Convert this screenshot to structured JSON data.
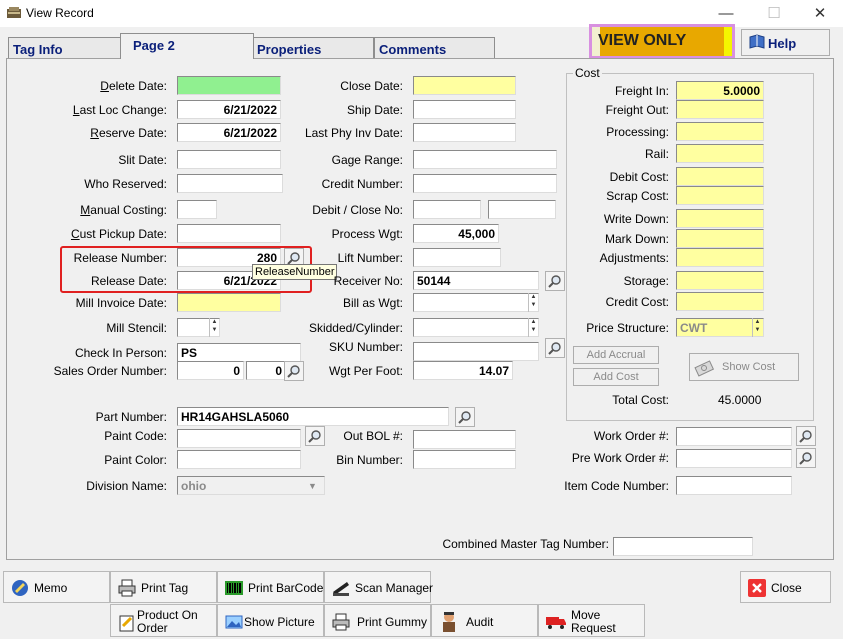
{
  "window": {
    "title": "View Record"
  },
  "tabs": [
    {
      "label": "Tag Info"
    },
    {
      "label": "Page 2"
    },
    {
      "label": "Properties"
    },
    {
      "label": "Comments"
    }
  ],
  "badge": {
    "text": "VIEW ONLY",
    "bg": "#e8a800",
    "border": "#d890e0"
  },
  "help_button": {
    "label": "Help"
  },
  "left": {
    "delete_date": {
      "label": "Delete Date:",
      "value": ""
    },
    "last_loc_change": {
      "label": "Last Loc Change:",
      "value": "6/21/2022"
    },
    "reserve_date": {
      "label": "Reserve Date:",
      "value": "6/21/2022"
    },
    "slit_date": {
      "label": "Slit Date:",
      "value": ""
    },
    "who_reserved": {
      "label": "Who Reserved:",
      "value": ""
    },
    "manual_costing": {
      "label": "Manual Costing:",
      "value": ""
    },
    "cust_pickup_date": {
      "label": "Cust Pickup Date:",
      "value": ""
    },
    "release_number": {
      "label": "Release Number:",
      "value": "280"
    },
    "release_date": {
      "label": "Release Date:",
      "value": "6/21/2022"
    },
    "mill_invoice_date": {
      "label": "Mill Invoice Date:",
      "value": ""
    },
    "mill_stencil": {
      "label": "Mill Stencil:",
      "value": ""
    },
    "check_in_person": {
      "label": "Check In Person:",
      "value": "PS"
    },
    "sales_order_number": {
      "label": "Sales Order Number:",
      "value1": "0",
      "value2": "0"
    }
  },
  "middle": {
    "close_date": {
      "label": "Close Date:",
      "value": ""
    },
    "ship_date": {
      "label": "Ship Date:",
      "value": ""
    },
    "last_phy_inv_date": {
      "label": "Last Phy Inv Date:",
      "value": ""
    },
    "gage_range": {
      "label": "Gage Range:",
      "value": ""
    },
    "credit_number": {
      "label": "Credit Number:",
      "value": ""
    },
    "debit_close_no": {
      "label": "Debit / Close No:",
      "value1": "",
      "value2": ""
    },
    "process_wgt": {
      "label": "Process Wgt:",
      "value": "45,000"
    },
    "lift_number": {
      "label": "Lift Number:",
      "value": ""
    },
    "receiver_no": {
      "label": "Receiver No:",
      "value": "50144"
    },
    "bill_as_wgt": {
      "label": "Bill as Wgt:",
      "value": ""
    },
    "skidded_cylinder": {
      "label": "Skidded/Cylinder:",
      "value": ""
    },
    "sku_number": {
      "label": "SKU Number:",
      "value": ""
    },
    "wgt_per_foot": {
      "label": "Wgt Per Foot:",
      "value": "14.07"
    }
  },
  "tooltip": {
    "text": "ReleaseNumber"
  },
  "cost": {
    "title": "Cost",
    "freight_in": {
      "label": "Freight In:",
      "value": "5.0000"
    },
    "freight_out": {
      "label": "Freight Out:",
      "value": ""
    },
    "processing": {
      "label": "Processing:",
      "value": ""
    },
    "rail": {
      "label": "Rail:",
      "value": ""
    },
    "debit_cost": {
      "label": "Debit Cost:",
      "value": ""
    },
    "scrap_cost": {
      "label": "Scrap Cost:",
      "value": ""
    },
    "write_down": {
      "label": "Write Down:",
      "value": ""
    },
    "mark_down": {
      "label": "Mark Down:",
      "value": ""
    },
    "adjustments": {
      "label": "Adjustments:",
      "value": ""
    },
    "storage": {
      "label": "Storage:",
      "value": ""
    },
    "credit_cost": {
      "label": "Credit Cost:",
      "value": ""
    },
    "price_structure": {
      "label": "Price Structure:",
      "value": "CWT"
    },
    "add_accrual": "Add Accrual",
    "add_cost": "Add Cost",
    "show_cost": "Show Cost",
    "total_cost": {
      "label": "Total Cost:",
      "value": "45.0000"
    }
  },
  "lower": {
    "part_number": {
      "label": "Part Number:",
      "value": "HR14GAHSLA5060"
    },
    "paint_code": {
      "label": "Paint Code:",
      "value": ""
    },
    "paint_color": {
      "label": "Paint Color:",
      "value": ""
    },
    "division_name": {
      "label": "Division Name:",
      "value": "ohio"
    },
    "out_bol": {
      "label": "Out BOL #:",
      "value": ""
    },
    "bin_number": {
      "label": "Bin Number:",
      "value": ""
    },
    "work_order": {
      "label": "Work Order #:",
      "value": ""
    },
    "pre_work_order": {
      "label": "Pre Work Order #:",
      "value": ""
    },
    "item_code_number": {
      "label": "Item Code Number:",
      "value": ""
    },
    "combined_master_tag": {
      "label": "Combined Master Tag Number:",
      "value": ""
    }
  },
  "buttons": {
    "memo": "Memo",
    "print_tag": "Print Tag",
    "print_barcode": "Print BarCode",
    "scan_manager": "Scan Manager",
    "close": "Close",
    "product_on_order_1": "Product On",
    "product_on_order_2": "Order",
    "show_picture": "Show Picture",
    "print_gummy": "Print Gummy",
    "audit": "Audit",
    "move_request_1": "Move",
    "move_request_2": "Request"
  },
  "colors": {
    "field_yellow": "#ffffa0",
    "field_green": "#90f090",
    "tab_text": "#0a1f7a",
    "highlight": "#e02020"
  }
}
